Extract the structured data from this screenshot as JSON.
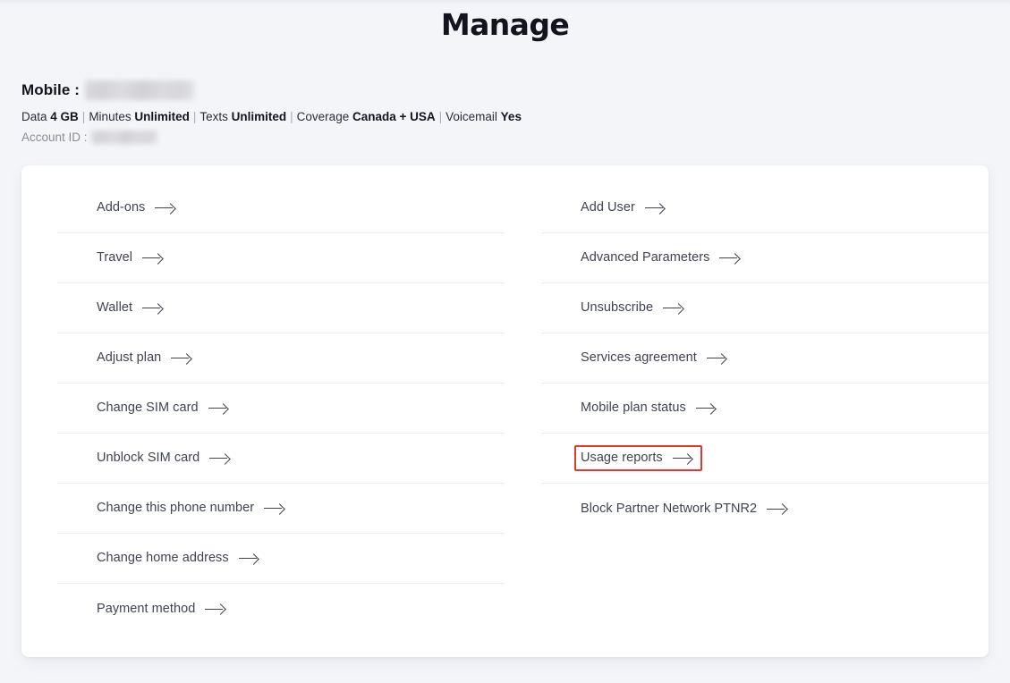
{
  "page": {
    "title": "Manage",
    "background_color": "#f4f5f9",
    "card_color": "#ffffff",
    "highlight_color": "#e03a2f"
  },
  "summary": {
    "mobile_label": "Mobile :",
    "mobile_number_redacted": true,
    "account_id_label": "Account ID :",
    "account_id_redacted": true,
    "plan": [
      {
        "key": "Data",
        "value": "4 GB"
      },
      {
        "key": "Minutes",
        "value": "Unlimited"
      },
      {
        "key": "Texts",
        "value": "Unlimited"
      },
      {
        "key": "Coverage",
        "value": "Canada + USA"
      },
      {
        "key": "Voicemail",
        "value": "Yes"
      }
    ],
    "separator": "|"
  },
  "menu": {
    "left_column": [
      {
        "label": "Add-ons",
        "icon": "arrow-right-icon",
        "highlighted": false
      },
      {
        "label": "Travel",
        "icon": "arrow-right-icon",
        "highlighted": false
      },
      {
        "label": "Wallet",
        "icon": "arrow-right-icon",
        "highlighted": false
      },
      {
        "label": "Adjust plan",
        "icon": "arrow-right-icon",
        "highlighted": false
      },
      {
        "label": "Change SIM card",
        "icon": "arrow-right-icon",
        "highlighted": false
      },
      {
        "label": "Unblock SIM card",
        "icon": "arrow-right-icon",
        "highlighted": false
      },
      {
        "label": "Change this phone number",
        "icon": "arrow-right-icon",
        "highlighted": false
      },
      {
        "label": "Change home address",
        "icon": "arrow-right-icon",
        "highlighted": false
      },
      {
        "label": "Payment method",
        "icon": "arrow-right-icon",
        "highlighted": false
      }
    ],
    "right_column": [
      {
        "label": "Add User",
        "icon": "arrow-right-icon",
        "highlighted": false
      },
      {
        "label": "Advanced Parameters",
        "icon": "arrow-right-icon",
        "highlighted": false
      },
      {
        "label": "Unsubscribe",
        "icon": "arrow-right-icon",
        "highlighted": false
      },
      {
        "label": "Services agreement",
        "icon": "arrow-right-icon",
        "highlighted": false
      },
      {
        "label": "Mobile plan status",
        "icon": "arrow-right-icon",
        "highlighted": false
      },
      {
        "label": "Usage reports",
        "icon": "arrow-right-icon",
        "highlighted": true
      },
      {
        "label": "Block Partner Network PTNR2",
        "icon": "arrow-right-icon",
        "highlighted": false
      }
    ]
  }
}
